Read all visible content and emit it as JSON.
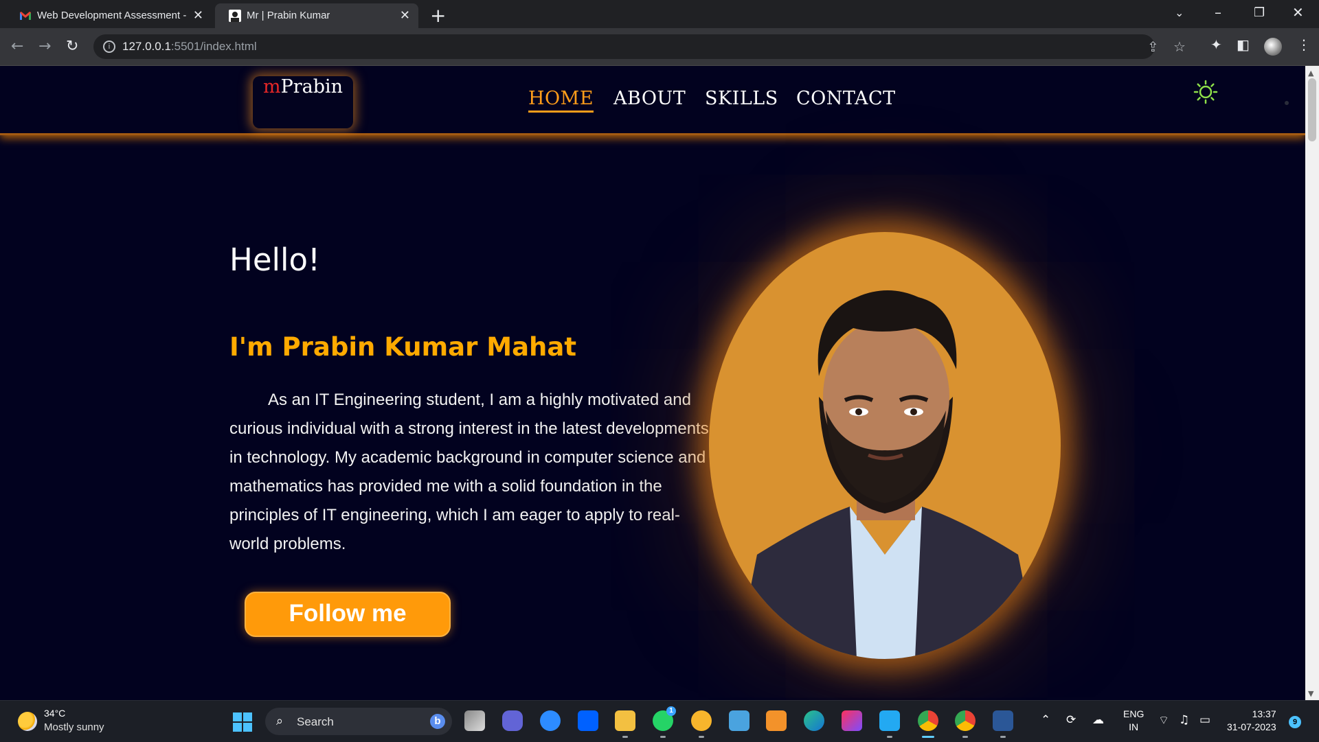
{
  "browser": {
    "tabs": [
      {
        "title": "Web Development Assessment -",
        "icon": "gmail-icon",
        "active": false
      },
      {
        "title": "Mr | Prabin Kumar",
        "icon": "portrait-icon",
        "active": true
      }
    ],
    "address": {
      "host": "127.0.0.1",
      "path": ":5501/index.html"
    }
  },
  "site": {
    "logo": {
      "accent": "m",
      "name": "Prabin"
    },
    "nav": [
      {
        "label": "HOME",
        "active": true
      },
      {
        "label": "ABOUT",
        "active": false
      },
      {
        "label": "SKILLS",
        "active": false
      },
      {
        "label": "CONTACT",
        "active": false
      }
    ],
    "theme_toggle_icon": "sun-icon",
    "hero": {
      "greeting": "Hello!",
      "name": "I'm Prabin Kumar Mahat",
      "bio": "As an IT Engineering student, I am a highly motivated and curious individual with a strong interest in the latest developments in technology. My academic background in computer science and mathematics has provided me with a solid foundation in the principles of IT engineering, which I am eager to apply to real-world problems.",
      "button": "Follow me",
      "photo": "profile-photo"
    },
    "colors": {
      "accent": "#ff9d1a",
      "background": "#02021f",
      "logo_m": "#e52727"
    }
  },
  "taskbar": {
    "weather": {
      "temp": "34°C",
      "desc": "Mostly sunny"
    },
    "search": "Search",
    "apps": [
      "task-view-icon",
      "teams-icon",
      "zoom-icon",
      "dropbox-icon",
      "file-explorer-icon",
      "whatsapp-icon",
      "maps-icon",
      "notepad-icon",
      "sublime-icon",
      "edge-icon",
      "intellij-icon",
      "vscode-icon",
      "chrome-icon",
      "chrome-profile-icon",
      "word-icon"
    ],
    "whatsapp_badge": "1",
    "lang": {
      "line1": "ENG",
      "line2": "IN"
    },
    "time": "13:37",
    "date": "31-07-2023",
    "notifications": "9"
  }
}
